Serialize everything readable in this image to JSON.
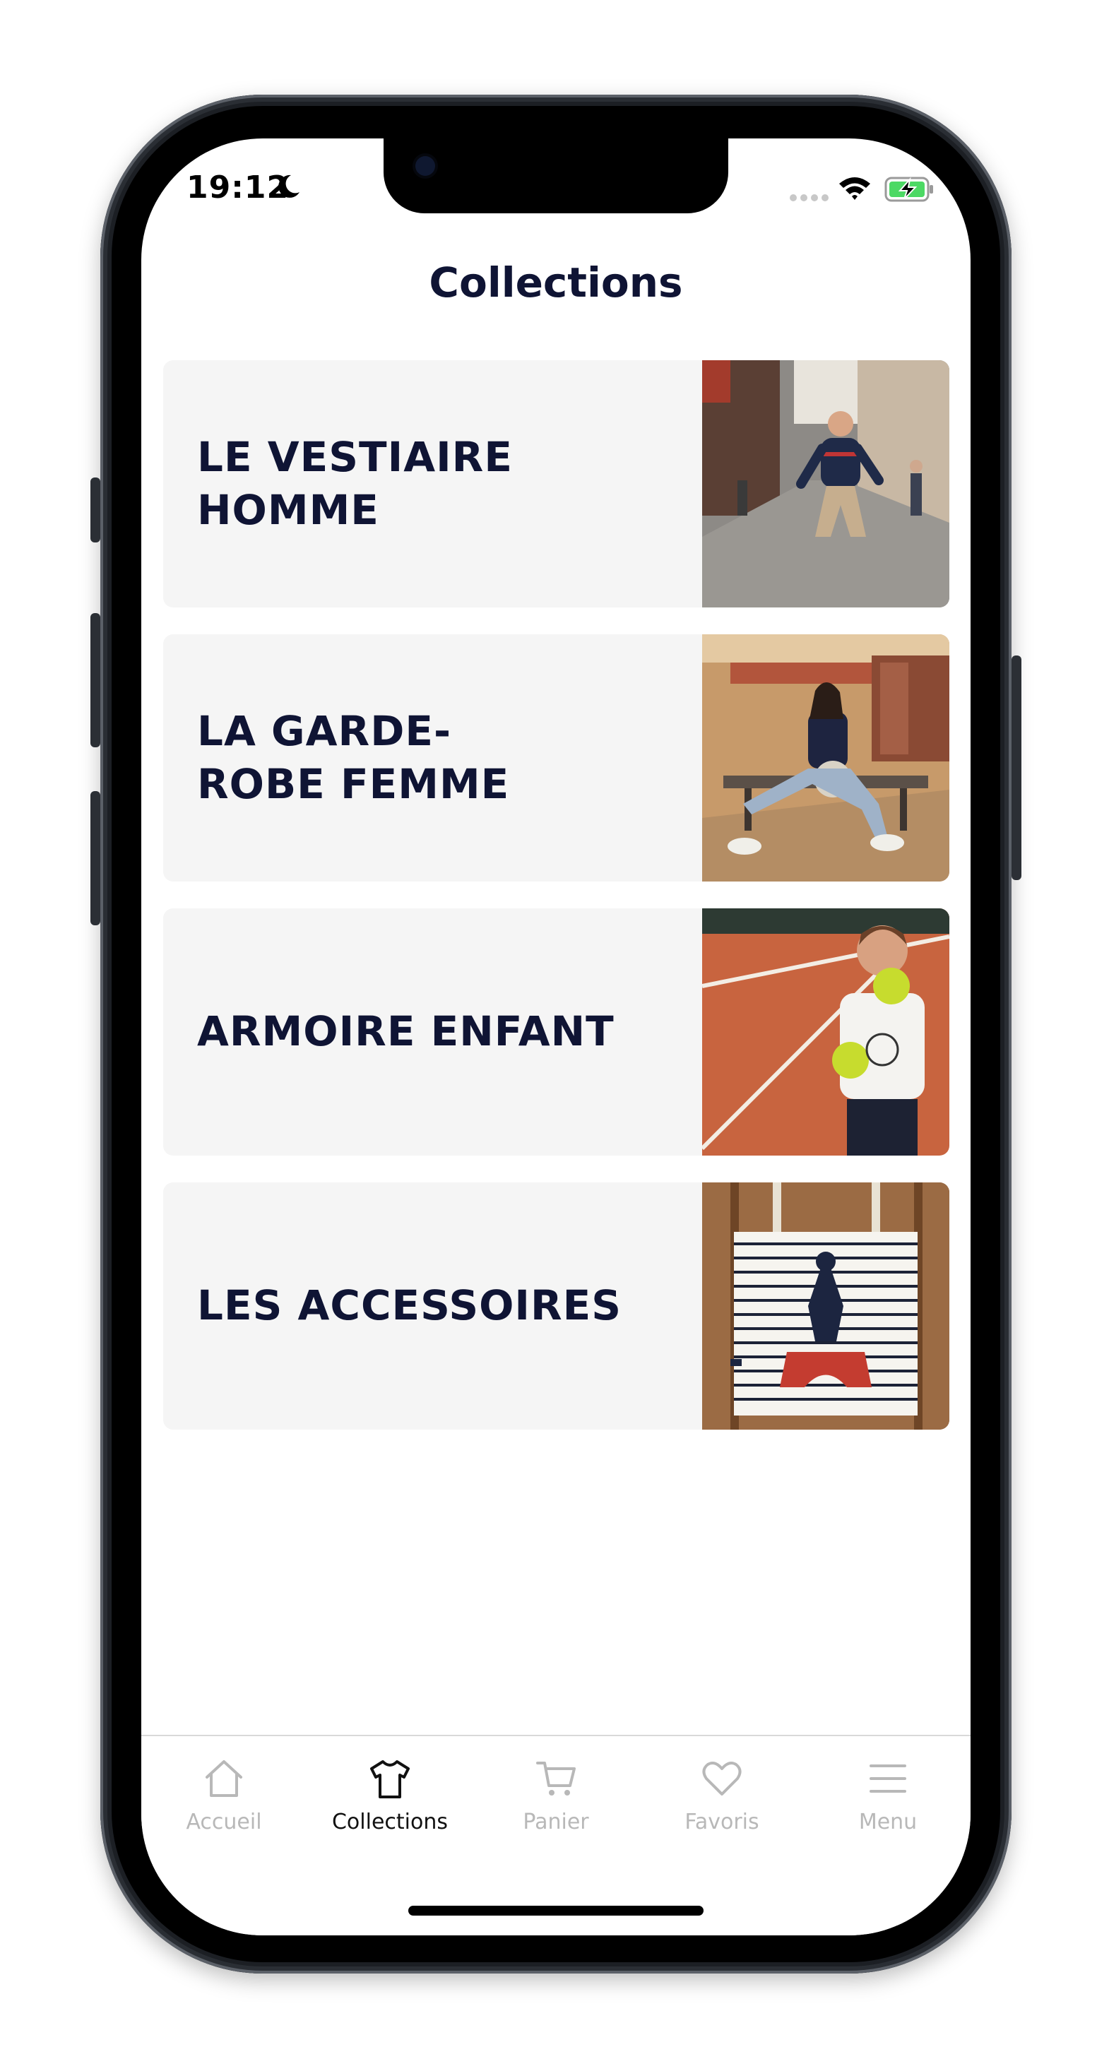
{
  "status_bar": {
    "time": "19:12",
    "icons": [
      "moon-icon",
      "signal-icon",
      "wifi-icon",
      "battery-charging-icon"
    ]
  },
  "header": {
    "title": "Collections"
  },
  "collections": [
    {
      "label": "LE VESTIAIRE\nHOMME",
      "image": "man-jumping-street-photo"
    },
    {
      "label": "LA GARDE-\nROBE FEMME",
      "image": "woman-on-bench-photo"
    },
    {
      "label": "ARMOIRE ENFANT",
      "image": "boy-tennis-court-photo"
    },
    {
      "label": "LES ACCESSOIRES",
      "image": "striped-tote-bag-photo"
    }
  ],
  "tabbar": {
    "tabs": [
      {
        "label": "Accueil",
        "icon": "home-icon",
        "active": false
      },
      {
        "label": "Collections",
        "icon": "tshirt-icon",
        "active": true
      },
      {
        "label": "Panier",
        "icon": "cart-icon",
        "active": false
      },
      {
        "label": "Favoris",
        "icon": "heart-icon",
        "active": false
      },
      {
        "label": "Menu",
        "icon": "menu-icon",
        "active": false
      }
    ]
  },
  "colors": {
    "text_primary": "#0f1434",
    "card_background": "#f5f5f5",
    "tab_inactive": "#b8b8b8",
    "tab_active": "#111111",
    "battery_green": "#4cd964"
  }
}
